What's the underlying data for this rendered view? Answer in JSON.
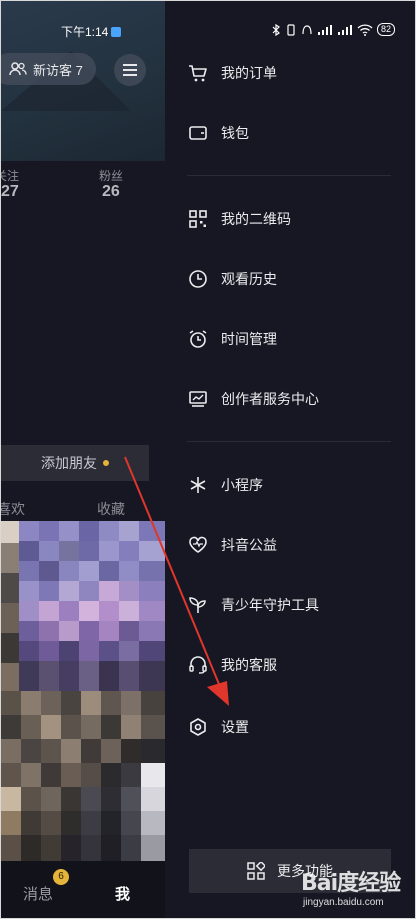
{
  "status_bar": {
    "time": "下午1:14",
    "battery": "82"
  },
  "profile": {
    "visitors_label": "新访客 7",
    "stats": [
      {
        "label": "关注",
        "value": "27"
      },
      {
        "label": "粉丝",
        "value": "26"
      }
    ],
    "add_friend_label": "添加朋友",
    "tabs": [
      "喜欢",
      "收藏"
    ]
  },
  "bottom_nav": {
    "messages_label": "消息",
    "messages_badge": "6",
    "me_label": "我"
  },
  "drawer": {
    "items": [
      {
        "label": "我的订单",
        "icon": "cart-icon"
      },
      {
        "label": "钱包",
        "icon": "wallet-icon"
      },
      {
        "label": "我的二维码",
        "icon": "qr-code-icon"
      },
      {
        "label": "观看历史",
        "icon": "clock-icon"
      },
      {
        "label": "时间管理",
        "icon": "alarm-clock-icon"
      },
      {
        "label": "创作者服务中心",
        "icon": "chart-monitor-icon"
      },
      {
        "label": "小程序",
        "icon": "asterisk-icon"
      },
      {
        "label": "抖音公益",
        "icon": "heart-pulse-icon"
      },
      {
        "label": "青少年守护工具",
        "icon": "sprout-icon"
      },
      {
        "label": "我的客服",
        "icon": "headset-icon"
      },
      {
        "label": "设置",
        "icon": "gear-icon"
      }
    ],
    "more_label": "更多功能"
  },
  "watermark": {
    "brand": "Bai度经验",
    "url": "jingyan.baidu.com"
  },
  "colors": {
    "background": "#161722",
    "accent_yellow": "#e5b43a",
    "annotation_red": "#e0362c"
  }
}
